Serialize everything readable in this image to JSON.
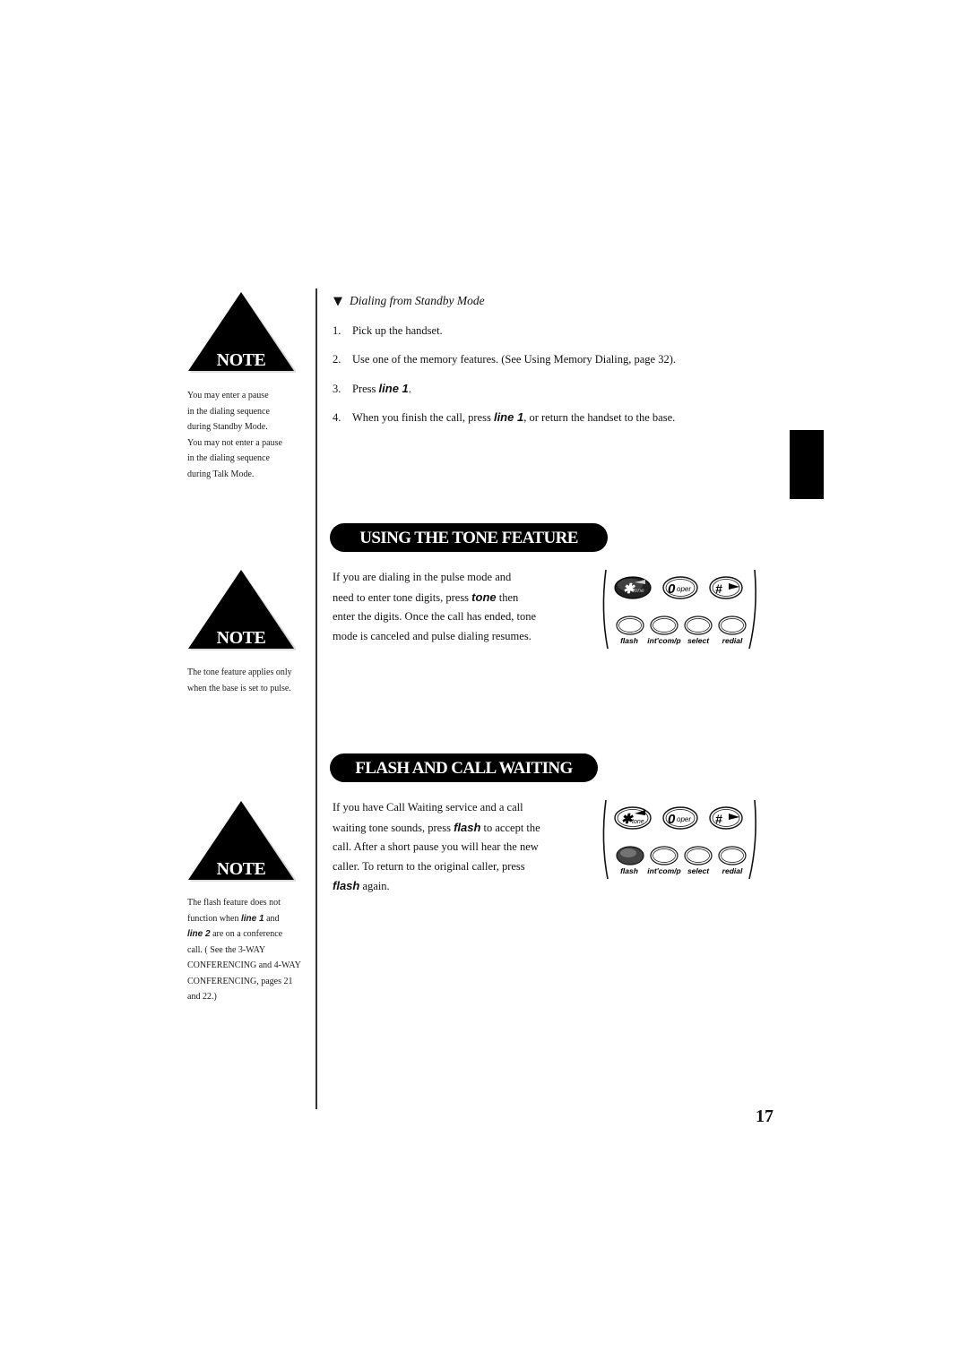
{
  "notes": [
    {
      "badge": "NOTE",
      "lines": [
        "You may enter a pause",
        "in the dialing sequence",
        "during Standby Mode.",
        "You may not enter a pause",
        "in the dialing sequence",
        "during Talk Mode."
      ]
    },
    {
      "badge": "NOTE",
      "lines": [
        "The tone feature applies only",
        "when the base is set to pulse."
      ]
    },
    {
      "badge": "NOTE",
      "line1_pre": "The flash feature does not",
      "line2_pre": "function when ",
      "line2_key": "line 1",
      "line2_post": " and",
      "line3_key": "line 2",
      "line3_post": " are on a conference",
      "line4": "call. ( See the 3-WAY",
      "line5": "CONFERENCING and 4-WAY",
      "line6": "CONFERENCING, pages 21",
      "line7": "and 22.)"
    }
  ],
  "standby": {
    "bullet_icon": "triangle-down-icon",
    "heading": "Dialing from Standby Mode",
    "steps": [
      {
        "num": "1.",
        "text": "Pick up the handset."
      },
      {
        "num": "2.",
        "text": "Use one of the memory features. (See Using Memory Dialing, page 32)."
      },
      {
        "num": "3.",
        "pre": "Press ",
        "key": "line 1",
        "post": "."
      },
      {
        "num": "4.",
        "pre": "When you finish the call, press ",
        "key": "line 1",
        "post": ", or return the handset to the base."
      }
    ]
  },
  "tone_section": {
    "title": "USING THE TONE FEATURE",
    "l1": "If you are dialing in the pulse mode and",
    "l2_pre": "need to enter tone digits, press ",
    "l2_key": "tone",
    "l2_post": " then",
    "l3": "enter the digits. Once the call has ended, tone",
    "l4": "mode is canceled and pulse dialing resumes.",
    "keypad": {
      "highlighted": "tone",
      "top_keys": [
        "✱",
        "tone",
        "0",
        "oper",
        "#"
      ],
      "bottom_labels": [
        "flash",
        "int'com/p",
        "select",
        "redial"
      ]
    }
  },
  "flash_section": {
    "title": "FLASH AND CALL WAITING",
    "l1": "If you have Call Waiting service and a call",
    "l2_pre": "waiting tone sounds, press ",
    "l2_key": "flash",
    "l2_post": " to accept the",
    "l3": "call. After a short pause you will hear the new",
    "l4": "caller. To return to the original caller, press",
    "l5_key": "flash",
    "l5_post": " again.",
    "keypad": {
      "highlighted": "flash",
      "top_keys": [
        "✱",
        "tone",
        "0",
        "oper",
        "#"
      ],
      "bottom_labels": [
        "flash",
        "int'com/p",
        "select",
        "redial"
      ]
    }
  },
  "page_number": "17"
}
